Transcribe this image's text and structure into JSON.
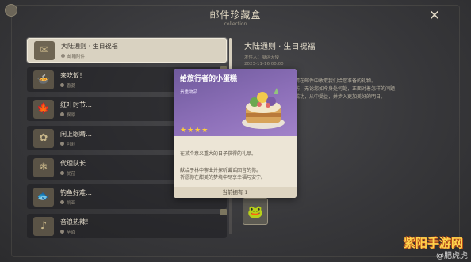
{
  "window": {
    "title": "邮件珍藏盒",
    "subtitle": "collection",
    "close_icon": "close-icon"
  },
  "mail_list": [
    {
      "title": "大陆通则 · 生日祝福",
      "tag": "邮箱附件",
      "icon": "gift-icon",
      "selected": true
    },
    {
      "title": "来吃饭！",
      "tag": "香菱",
      "icon": "food-icon",
      "selected": false
    },
    {
      "title": "红叶时节…",
      "tag": "枫原",
      "icon": "leaf-icon",
      "selected": false
    },
    {
      "title": "闲上眼睛…",
      "tag": "可莉",
      "icon": "flower-icon",
      "selected": false
    },
    {
      "title": "代理队长…",
      "tag": "优菈",
      "icon": "ice-icon",
      "selected": false
    },
    {
      "title": "钓鱼好难…",
      "tag": "凯亚",
      "icon": "fish-icon",
      "selected": false
    },
    {
      "title": "音浪热辣！",
      "tag": "辛焱",
      "icon": "music-icon",
      "selected": false
    }
  ],
  "detail": {
    "title": "大陆通则 · 生日祝福",
    "sender": "发件人：凝运天使",
    "time": "2023-11-16 00:00",
    "body_lines": [
      "请在邮件中收取我们给您准备的礼物。",
      "彷，无论您如今身处何处，正面对着怎样的问题，",
      "成功，从中受益，并步入更加美好的明日。"
    ]
  },
  "popup": {
    "name": "给旅行者的小蛋糕",
    "category": "贵重物品",
    "stars": "★★★★",
    "desc1": "在某个意义重大的日子获得的礼品。",
    "desc2_line1": "献给于林中寨曲并探听谶谣回音的你。",
    "desc2_line2": "祈愿你在甜美的梦境中尽享幸福与安宁。",
    "owned": "当前拥有 1"
  },
  "watermark": {
    "text": "@肥虎虎",
    "logo": "紫阳手游网"
  },
  "colors": {
    "background": "#3a3a3c",
    "selected_item": "#d9d2c1",
    "popup_header": "#8c6fb8",
    "stars": "#ffcf3a",
    "popup_body": "#ece5d6"
  }
}
